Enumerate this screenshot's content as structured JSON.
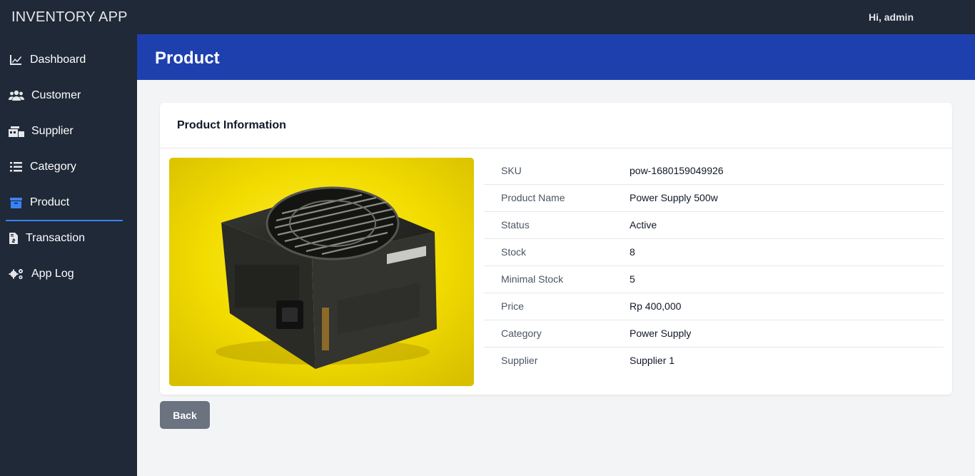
{
  "app": {
    "title": "INVENTORY APP",
    "greeting": "Hi, admin"
  },
  "sidebar": {
    "items": [
      {
        "label": "Dashboard",
        "icon": "chart-line-icon"
      },
      {
        "label": "Customer",
        "icon": "users-icon"
      },
      {
        "label": "Supplier",
        "icon": "warehouse-icon"
      },
      {
        "label": "Category",
        "icon": "list-icon"
      },
      {
        "label": "Product",
        "icon": "box-icon",
        "active": true
      },
      {
        "label": "Transaction",
        "icon": "invoice-icon"
      },
      {
        "label": "App Log",
        "icon": "gears-icon"
      }
    ]
  },
  "page": {
    "title": "Product"
  },
  "card": {
    "title": "Product Information",
    "image_icon": "power-supply-photo",
    "rows": [
      {
        "label": "SKU",
        "value": "pow-1680159049926"
      },
      {
        "label": "Product Name",
        "value": "Power Supply 500w"
      },
      {
        "label": "Status",
        "value": "Active"
      },
      {
        "label": "Stock",
        "value": "8"
      },
      {
        "label": "Minimal Stock",
        "value": "5"
      },
      {
        "label": "Price",
        "value": "Rp 400,000"
      },
      {
        "label": "Category",
        "value": "Power Supply"
      },
      {
        "label": "Supplier",
        "value": "Supplier 1"
      }
    ]
  },
  "actions": {
    "back_label": "Back"
  },
  "colors": {
    "sidebar": "#1f2937",
    "header": "#1e40af",
    "accent": "#3b82f6",
    "button": "#6b7280"
  }
}
